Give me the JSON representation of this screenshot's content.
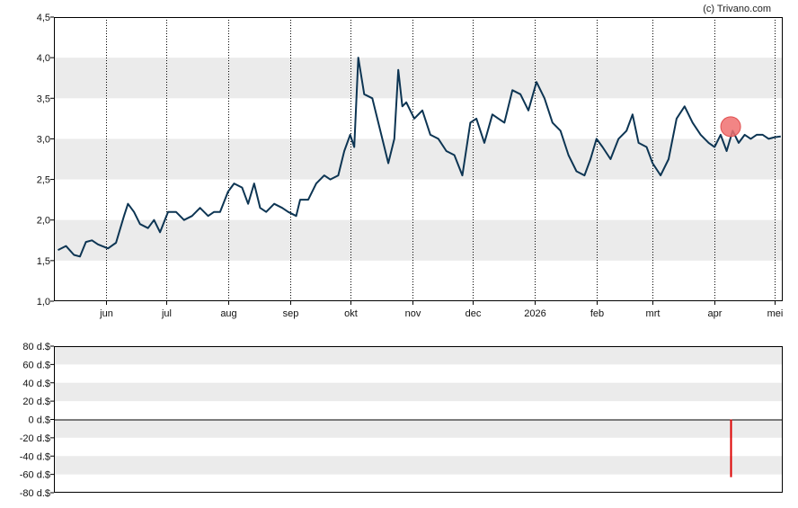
{
  "credit": "(c) Trivano.com",
  "colors": {
    "line": "#0d3553",
    "band": "#ebebeb",
    "grid": "#000000",
    "marker_fill": "#f07070",
    "marker_stroke": "#e05050",
    "volume_bar": "#dd0000"
  },
  "chart_data": [
    {
      "type": "line",
      "title": "",
      "xlabel": "",
      "ylabel": "",
      "ylim": [
        1.0,
        4.5
      ],
      "yticks": [
        "1,0",
        "1,5",
        "2,0",
        "2,5",
        "3,0",
        "3,5",
        "4,0",
        "4,5"
      ],
      "xticks": [
        "jun",
        "jul",
        "aug",
        "sep",
        "okt",
        "nov",
        "dec",
        "2026",
        "feb",
        "mrt",
        "apr",
        "mei"
      ],
      "grid": "vertical dotted lines at month ticks, alternating horizontal bands",
      "series": [
        {
          "x": [
            "2025-05-08",
            "2025-05-12",
            "2025-05-16",
            "2025-05-19",
            "2025-05-22",
            "2025-05-25",
            "2025-05-28",
            "2025-06-02",
            "2025-06-06",
            "2025-06-10",
            "2025-06-12",
            "2025-06-15",
            "2025-06-18",
            "2025-06-22",
            "2025-06-25",
            "2025-06-28",
            "2025-07-02",
            "2025-07-06",
            "2025-07-10",
            "2025-07-14",
            "2025-07-18",
            "2025-07-22",
            "2025-07-25",
            "2025-07-28",
            "2025-08-01",
            "2025-08-04",
            "2025-08-08",
            "2025-08-11",
            "2025-08-14",
            "2025-08-17",
            "2025-08-20",
            "2025-08-24",
            "2025-08-28",
            "2025-08-31",
            "2025-09-04",
            "2025-09-06",
            "2025-09-10",
            "2025-09-14",
            "2025-09-18",
            "2025-09-21",
            "2025-09-25",
            "2025-09-28",
            "2025-10-01",
            "2025-10-03",
            "2025-10-05",
            "2025-10-08",
            "2025-10-12",
            "2025-10-16",
            "2025-10-20",
            "2025-10-23",
            "2025-10-25",
            "2025-10-27",
            "2025-10-29",
            "2025-11-02",
            "2025-11-06",
            "2025-11-10",
            "2025-11-14",
            "2025-11-18",
            "2025-11-22",
            "2025-11-26",
            "2025-11-30",
            "2025-12-03",
            "2025-12-07",
            "2025-12-11",
            "2025-12-14",
            "2025-12-17",
            "2025-12-21",
            "2025-12-25",
            "2025-12-29",
            "2026-01-02",
            "2026-01-06",
            "2026-01-10",
            "2026-01-14",
            "2026-01-18",
            "2026-01-22",
            "2026-01-26",
            "2026-01-29",
            "2026-02-01",
            "2026-02-04",
            "2026-02-08",
            "2026-02-12",
            "2026-02-16",
            "2026-02-19",
            "2026-02-22",
            "2026-02-26",
            "2026-03-01",
            "2026-03-05",
            "2026-03-09",
            "2026-03-13",
            "2026-03-17",
            "2026-03-21",
            "2026-03-25",
            "2026-03-29",
            "2026-04-01",
            "2026-04-04",
            "2026-04-07",
            "2026-04-10",
            "2026-04-13",
            "2026-04-16",
            "2026-04-19",
            "2026-04-22",
            "2026-04-25",
            "2026-04-28",
            "2026-05-01",
            "2026-05-04"
          ],
          "values": [
            1.63,
            1.68,
            1.57,
            1.55,
            1.73,
            1.75,
            1.7,
            1.65,
            1.72,
            2.05,
            2.2,
            2.1,
            1.95,
            1.9,
            2.0,
            1.85,
            2.1,
            2.1,
            2.0,
            2.05,
            2.15,
            2.05,
            2.1,
            2.1,
            2.35,
            2.45,
            2.4,
            2.2,
            2.45,
            2.15,
            2.1,
            2.2,
            2.15,
            2.1,
            2.05,
            2.25,
            2.25,
            2.45,
            2.55,
            2.5,
            2.55,
            2.85,
            3.05,
            2.9,
            4.0,
            3.55,
            3.5,
            3.1,
            2.7,
            3.0,
            3.85,
            3.4,
            3.45,
            3.25,
            3.35,
            3.05,
            3.0,
            2.85,
            2.8,
            2.55,
            3.2,
            3.25,
            2.95,
            3.3,
            3.25,
            3.2,
            3.6,
            3.55,
            3.35,
            3.7,
            3.5,
            3.2,
            3.1,
            2.8,
            2.6,
            2.55,
            2.75,
            3.0,
            2.9,
            2.75,
            3.0,
            3.1,
            3.3,
            2.95,
            2.9,
            2.7,
            2.55,
            2.75,
            3.25,
            3.4,
            3.2,
            3.05,
            2.95,
            2.9,
            3.05,
            2.85,
            3.1,
            2.95,
            3.05,
            3.0,
            3.05,
            3.05,
            3.0,
            3.02,
            3.03
          ]
        }
      ],
      "marker": {
        "x": "2026-04-09",
        "y": 3.15
      }
    },
    {
      "type": "bar",
      "title": "",
      "xlabel": "",
      "ylabel": "",
      "ylim": [
        -80,
        80
      ],
      "yticks": [
        "-80 d.$",
        "-60 d.$",
        "-40 d.$",
        "-20 d.$",
        "0 d.$",
        "20 d.$",
        "40 d.$",
        "60 d.$",
        "80 d.$"
      ],
      "grid": "alternating horizontal bands",
      "series": [
        {
          "x": [
            "2026-04-09"
          ],
          "values": [
            -63
          ]
        }
      ]
    }
  ]
}
